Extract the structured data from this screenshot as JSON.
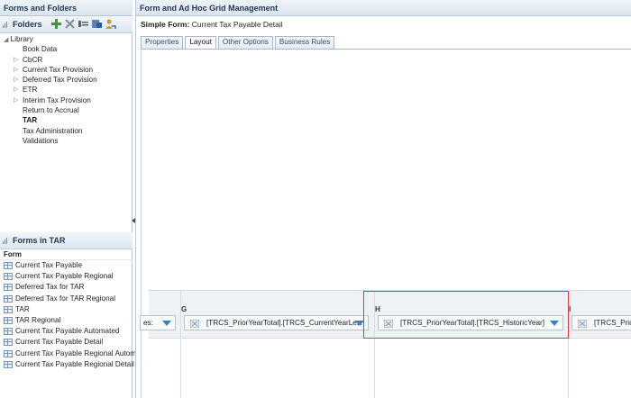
{
  "left_pane": {
    "title": "Forms and Folders",
    "folders_header": "Folders",
    "toolbar_icons": [
      "add-folder-icon",
      "delete-icon",
      "rename-icon",
      "move-icon",
      "assign-access-icon"
    ],
    "tree": [
      {
        "label": "Library",
        "level": 0,
        "expanded": true
      },
      {
        "label": "Book Data",
        "level": 1,
        "expandable": false
      },
      {
        "label": "CbCR",
        "level": 1,
        "expandable": true
      },
      {
        "label": "Current Tax Provision",
        "level": 1,
        "expandable": true
      },
      {
        "label": "Deferred Tax Provision",
        "level": 1,
        "expandable": true
      },
      {
        "label": "ETR",
        "level": 1,
        "expandable": true
      },
      {
        "label": "Interim Tax Provision",
        "level": 1,
        "expandable": true
      },
      {
        "label": "Return to Accrual",
        "level": 1,
        "expandable": false
      },
      {
        "label": "TAR",
        "level": 1,
        "expandable": false,
        "selected": true
      },
      {
        "label": "Tax Administration",
        "level": 1,
        "expandable": false
      },
      {
        "label": "Validations",
        "level": 1,
        "expandable": false
      }
    ],
    "forms_header": "Forms in TAR",
    "forms_column": "Form",
    "forms": [
      "Current Tax Payable",
      "Current Tax Payable Regional",
      "Deferred Tax for TAR",
      "Deferred Tax for TAR Regional",
      "TAR",
      "TAR Regional",
      "Current Tax Payable Automated",
      "Current Tax Payable Detail",
      "Current Tax Payable Regional Autom",
      "Current Tax Payable Regional Detail"
    ]
  },
  "right_pane": {
    "title": "Form and Ad Hoc Grid Management",
    "form_label": "Simple Form:",
    "form_name": "Current Tax Payable Detail",
    "tabs": [
      "Properties",
      "Layout",
      "Other Options",
      "Business Rules"
    ],
    "active_tab": "Layout",
    "grid": {
      "columns": [
        {
          "letter": "",
          "member": "es:"
        },
        {
          "letter": "G",
          "member": "[TRCS_PriorYearTotal].[TRCS_CurrentYearLes:"
        },
        {
          "letter": "H",
          "member": "[TRCS_PriorYearTotal].[TRCS_HistoricYear]"
        },
        {
          "letter": "I",
          "member": "[TRCS_Prior"
        }
      ]
    }
  },
  "colors": {
    "accent": "#233a5a",
    "highlight": "#e03c3c",
    "dropdown": "#3f7fc4"
  }
}
